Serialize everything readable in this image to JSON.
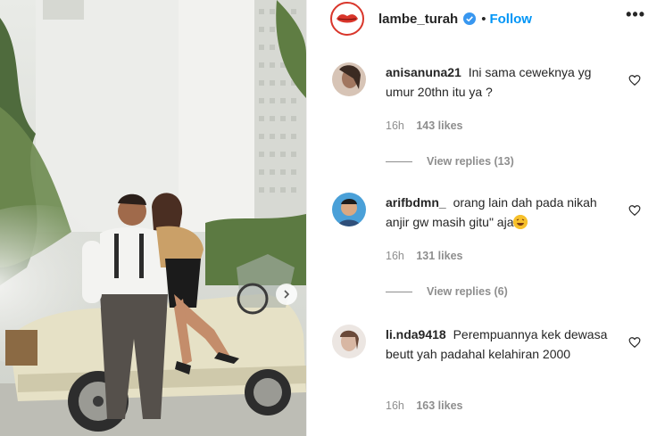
{
  "post": {
    "username": "lambe_turah",
    "dot": "•",
    "follow_label": "Follow",
    "more_label": "•••"
  },
  "comments": [
    {
      "user": "anisanuna21",
      "text": "Ini sama ceweknya yg umur 20thn itu ya ?",
      "time": "16h",
      "likes": "143 likes",
      "replies": "View replies (13)"
    },
    {
      "user": "arifbdmn_",
      "text": "orang lain dah pada nikah anjir gw masih gitu\" aja",
      "time": "16h",
      "likes": "131 likes",
      "replies": "View replies (6)"
    },
    {
      "user": "li.nda9418",
      "text": "Perempuannya kek dewasa beutt yah padahal kelahiran 2000",
      "time": "16h",
      "likes": "163 likes"
    }
  ],
  "colors": {
    "link": "#0095f6",
    "muted": "#8e8e8e",
    "text": "#262626",
    "logo_red": "#d9362b"
  },
  "icons": [
    "verified-badge-icon",
    "more-options-icon",
    "heart-icon",
    "next-arrow-icon",
    "laughing-emoji-icon"
  ]
}
